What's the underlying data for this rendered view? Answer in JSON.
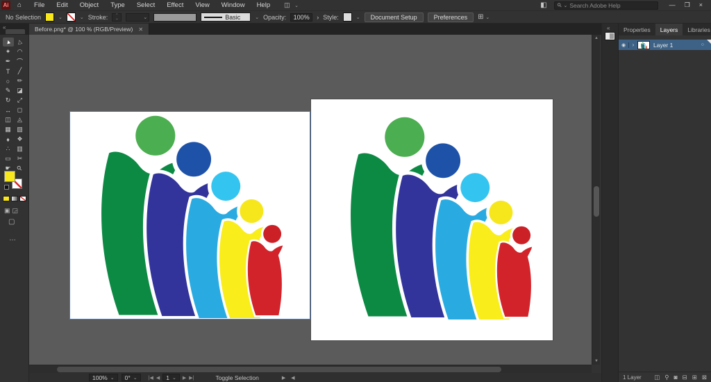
{
  "window": {
    "brand": "Ai",
    "menus": [
      "File",
      "Edit",
      "Object",
      "Type",
      "Select",
      "Effect",
      "View",
      "Window",
      "Help"
    ],
    "search_placeholder": "Search Adobe Help",
    "window_controls": [
      {
        "name": "minimize-button",
        "glyph": "—"
      },
      {
        "name": "restore-button",
        "glyph": "❐"
      },
      {
        "name": "close-button",
        "glyph": "×"
      }
    ]
  },
  "control_bar": {
    "selection_status": "No Selection",
    "stroke_label": "Stroke:",
    "brush_name": "Basic",
    "opacity_label": "Opacity:",
    "opacity_value": "100%",
    "opacity_more": "›",
    "style_label": "Style:",
    "document_setup_label": "Document Setup",
    "preferences_label": "Preferences"
  },
  "document_tab": {
    "title": "Before.png* @ 100 % (RGB/Preview)",
    "close_glyph": "✕"
  },
  "tools": [
    {
      "name": "selection-tool",
      "glyph": "►",
      "active": true
    },
    {
      "name": "direct-selection-tool",
      "glyph": "▷"
    },
    {
      "name": "magic-wand-tool",
      "glyph": "✦"
    },
    {
      "name": "lasso-tool",
      "glyph": "◠"
    },
    {
      "name": "pen-tool",
      "glyph": "✒"
    },
    {
      "name": "curvature-tool",
      "glyph": "⌒"
    },
    {
      "name": "type-tool",
      "glyph": "T"
    },
    {
      "name": "line-segment-tool",
      "glyph": "╱"
    },
    {
      "name": "ellipse-tool",
      "glyph": "○"
    },
    {
      "name": "paintbrush-tool",
      "glyph": "✏"
    },
    {
      "name": "pencil-tool",
      "glyph": "✎"
    },
    {
      "name": "eraser-tool",
      "glyph": "◪"
    },
    {
      "name": "rotate-tool",
      "glyph": "↻"
    },
    {
      "name": "scale-tool",
      "glyph": "⤢"
    },
    {
      "name": "width-tool",
      "glyph": "↔"
    },
    {
      "name": "free-transform-tool",
      "glyph": "◻"
    },
    {
      "name": "shape-builder-tool",
      "glyph": "◫"
    },
    {
      "name": "perspective-grid-tool",
      "glyph": "◬"
    },
    {
      "name": "mesh-tool",
      "glyph": "▦"
    },
    {
      "name": "gradient-tool",
      "glyph": "▧"
    },
    {
      "name": "eyedropper-tool",
      "glyph": "♦"
    },
    {
      "name": "blend-tool",
      "glyph": "❖"
    },
    {
      "name": "symbol-sprayer-tool",
      "glyph": "∴"
    },
    {
      "name": "column-graph-tool",
      "glyph": "▥"
    },
    {
      "name": "artboard-tool",
      "glyph": "▭"
    },
    {
      "name": "slice-tool",
      "glyph": "✂"
    },
    {
      "name": "hand-tool",
      "glyph": "☛"
    },
    {
      "name": "zoom-tool",
      "glyph": "⚲"
    }
  ],
  "panel": {
    "tabs": [
      "Properties",
      "Layers",
      "Libraries"
    ],
    "active_tab": "Layers",
    "layer_name": "Layer 1",
    "footer_count": "1 Layer",
    "footer_icons": [
      {
        "name": "collect-for-export-icon",
        "glyph": "◫"
      },
      {
        "name": "locate-object-icon",
        "glyph": "⚲"
      },
      {
        "name": "clipping-mask-icon",
        "glyph": "◙"
      },
      {
        "name": "new-sublayer-icon",
        "glyph": "⊟"
      },
      {
        "name": "new-layer-icon",
        "glyph": "⊞"
      },
      {
        "name": "delete-layer-icon",
        "glyph": "⊠"
      }
    ]
  },
  "status_bar": {
    "zoom": "100%",
    "rotation": "0°",
    "artboard_number": "1",
    "message": "Toggle Selection"
  },
  "logo_colors": {
    "green_body": "#0c8a44",
    "green_head": "#4bae50",
    "blue_body": "#32339b",
    "blue_head": "#1e52a9",
    "cyan_body": "#29abe2",
    "cyan_head": "#33c5f0",
    "yellow_body": "#f9ed1b",
    "yellow_head": "#f6e71d",
    "red_body": "#d2232a",
    "red_head": "#cb2026"
  },
  "ui_colors": {
    "selection_outline": "#4a7cc0",
    "fill_swatch": "#f7e71c",
    "layer_row_highlight": "#3d6286"
  }
}
